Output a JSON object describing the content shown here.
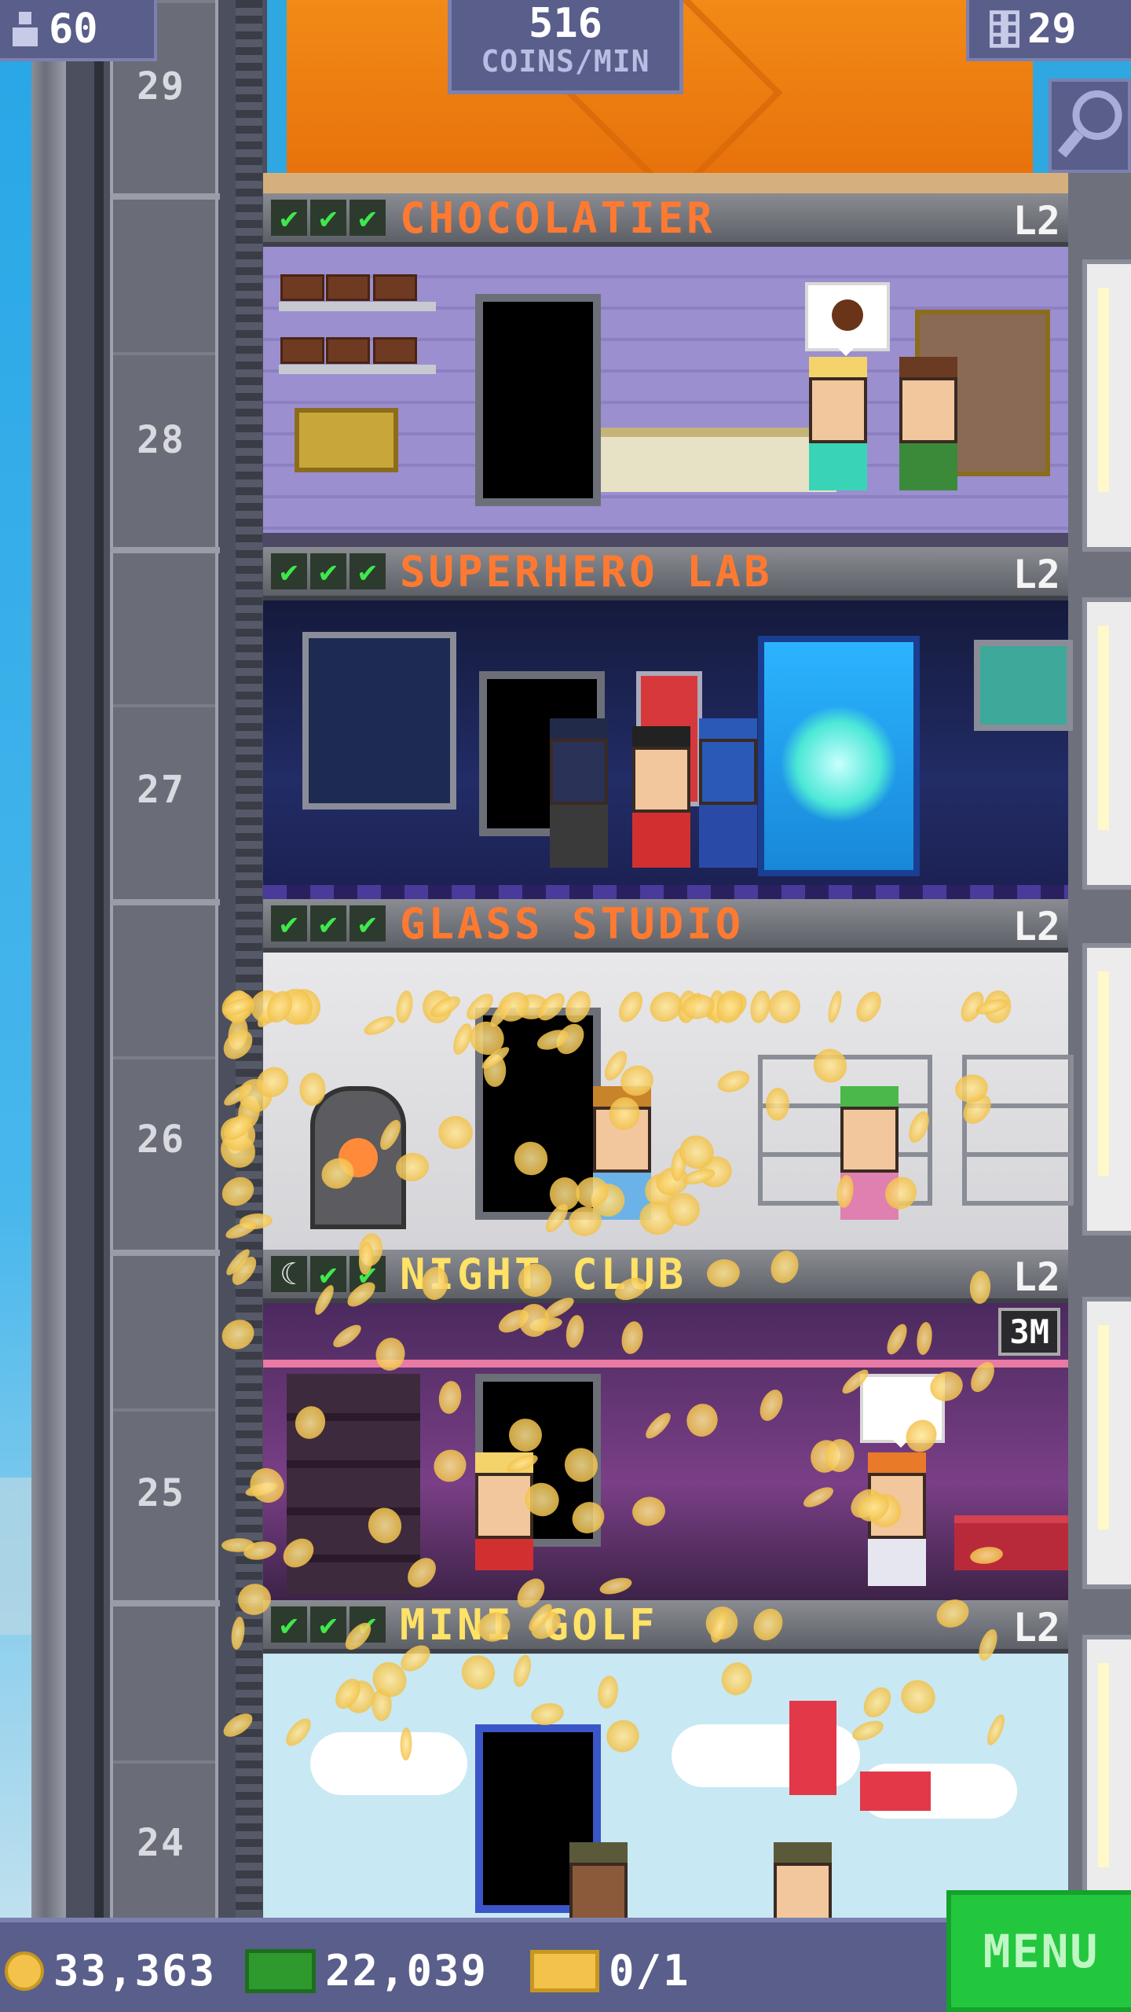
{
  "hud": {
    "population": "60",
    "coins_per_min_value": "516",
    "coins_per_min_label": "COINS/MIN",
    "floor_count": "29"
  },
  "shaft_floor_numbers": [
    "29",
    "28",
    "27",
    "26",
    "25",
    "24"
  ],
  "floors": [
    {
      "name": "CHOCOLATIER",
      "level": "L2",
      "checks": 3
    },
    {
      "name": "SUPERHERO LAB",
      "level": "L2",
      "checks": 3
    },
    {
      "name": "GLASS STUDIO",
      "level": "L2",
      "checks": 3
    },
    {
      "name": "NIGHT CLUB",
      "level": "L2",
      "checks": 2,
      "timer": "3M"
    },
    {
      "name": "MINI GOLF",
      "level": "L2",
      "checks": 3
    }
  ],
  "bottom": {
    "coins": "33,363",
    "bux": "22,039",
    "tickets": "0/1",
    "menu_label": "MENU"
  },
  "colors": {
    "hud_bg": "#5a5e8a",
    "menu_green": "#23c73e",
    "floor_name_orange": "#ff7a30",
    "floor_name_yellow": "#ffe266",
    "check_green": "#3ee84c"
  },
  "icons": {
    "population": "person-icon",
    "floors": "building-icon",
    "search": "magnifier-icon",
    "coins": "coin-icon",
    "bux": "bux-icon",
    "tickets": "ticket-icon"
  }
}
